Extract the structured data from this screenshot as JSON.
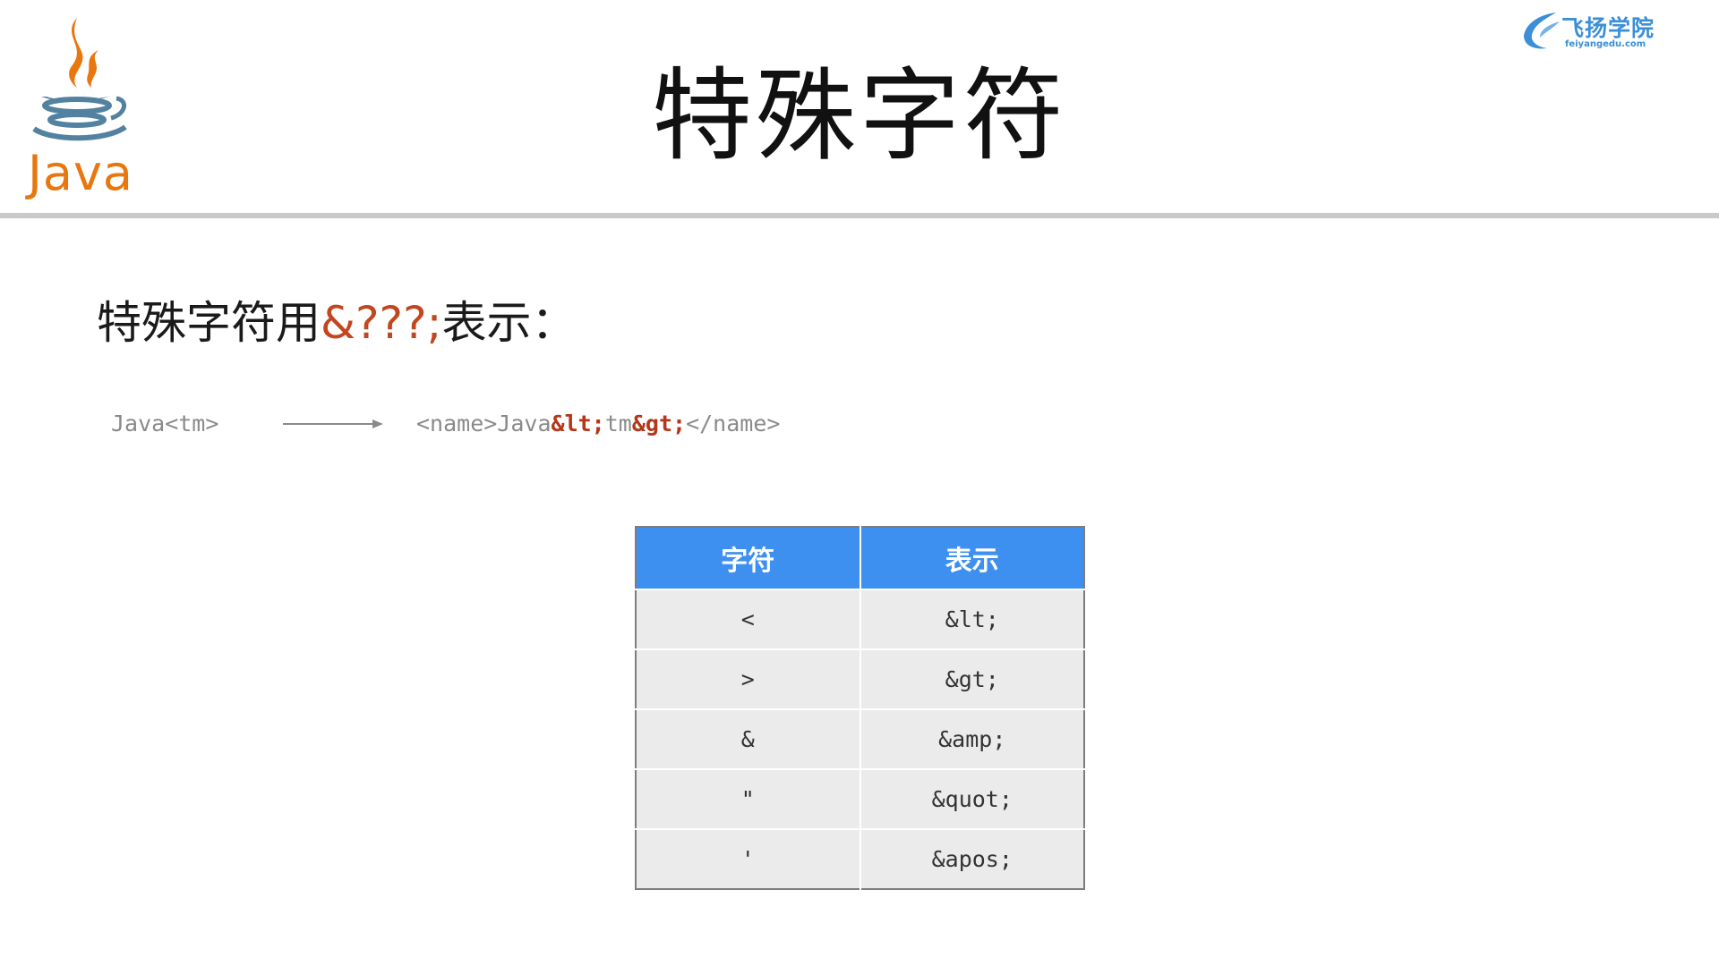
{
  "header": {
    "logo_word": "Java",
    "brand_name": "飞扬学院",
    "brand_url": "feiyangedu.com",
    "title": "特殊字符"
  },
  "intro": {
    "lead": "特殊字符用",
    "code": "&???;",
    "tail": "表示："
  },
  "example": {
    "source": "Java<tm>",
    "target_parts": [
      {
        "text": "<name>Java",
        "highlight": false
      },
      {
        "text": "&lt;",
        "highlight": true
      },
      {
        "text": "tm",
        "highlight": false
      },
      {
        "text": "&gt;",
        "highlight": true
      },
      {
        "text": "</name>",
        "highlight": false
      }
    ]
  },
  "table": {
    "headers": [
      "字符",
      "表示"
    ],
    "rows": [
      [
        "<",
        "&lt;"
      ],
      [
        ">",
        "&gt;"
      ],
      [
        "&",
        "&amp;"
      ],
      [
        "\"",
        "&quot;"
      ],
      [
        "'",
        "&apos;"
      ]
    ]
  },
  "colors": {
    "java_orange": "#e8770f",
    "java_blue": "#5382a1",
    "brand_blue": "#3a8fd6",
    "accent_red": "#c2461f",
    "table_header": "#3d8ff0",
    "table_cell": "#ebebeb",
    "rule": "#c9c9c9"
  }
}
